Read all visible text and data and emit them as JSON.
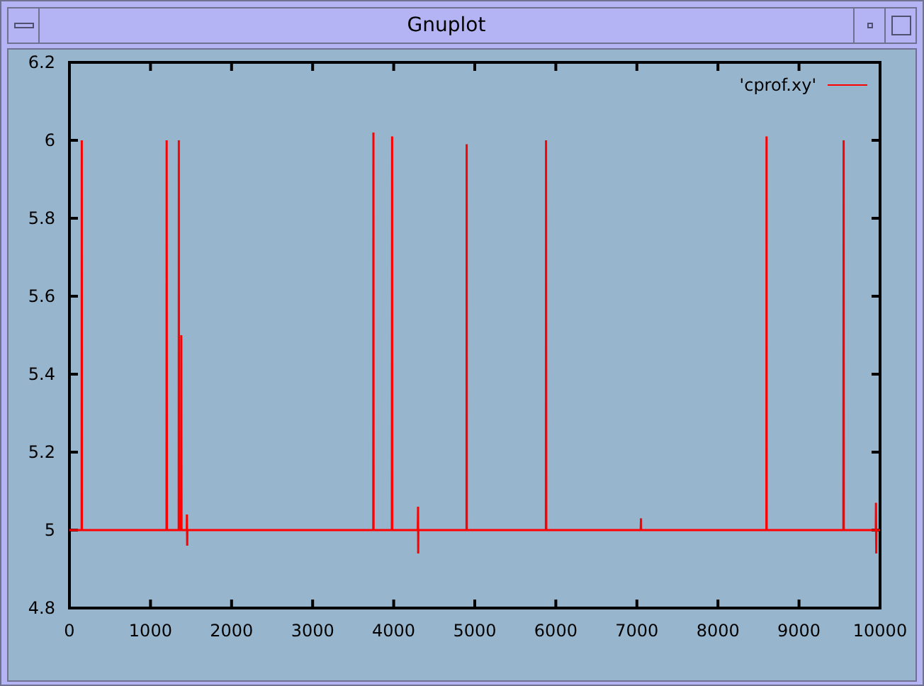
{
  "window": {
    "title": "Gnuplot"
  },
  "plot": {
    "chart_data": {
      "type": "line",
      "x": [
        0,
        150,
        152,
        154,
        1198,
        1200,
        1202,
        1348,
        1350,
        1352,
        1378,
        1380,
        1382,
        1448,
        1450,
        1452,
        1454,
        3748,
        3750,
        3752,
        3978,
        3980,
        3982,
        4298,
        4300,
        4302,
        4304,
        4898,
        4900,
        4902,
        5878,
        5880,
        5882,
        7048,
        7050,
        7052,
        8598,
        8600,
        8602,
        9548,
        9550,
        9552,
        9948,
        9950,
        9952,
        9954,
        10000
      ],
      "series": [
        {
          "name": "'cprof.xy'",
          "color": "#ff0000",
          "values": [
            5,
            5,
            6.0,
            5,
            5,
            6.0,
            5,
            5,
            6.0,
            5,
            5,
            5.5,
            5,
            5,
            5.04,
            4.96,
            5,
            5,
            6.02,
            5,
            5,
            6.01,
            5,
            5,
            5.06,
            4.94,
            5,
            5,
            5.99,
            5,
            5,
            6.0,
            5,
            5,
            5.03,
            5,
            5,
            6.01,
            5,
            5,
            6.0,
            5,
            5,
            5.07,
            4.94,
            5,
            5
          ]
        }
      ],
      "xlim": [
        0,
        10000
      ],
      "ylim": [
        4.8,
        6.2
      ],
      "xticks": [
        0,
        1000,
        2000,
        3000,
        4000,
        5000,
        6000,
        7000,
        8000,
        9000,
        10000
      ],
      "yticks": [
        4.8,
        5,
        5.2,
        5.4,
        5.6,
        5.8,
        6,
        6.2
      ]
    }
  }
}
